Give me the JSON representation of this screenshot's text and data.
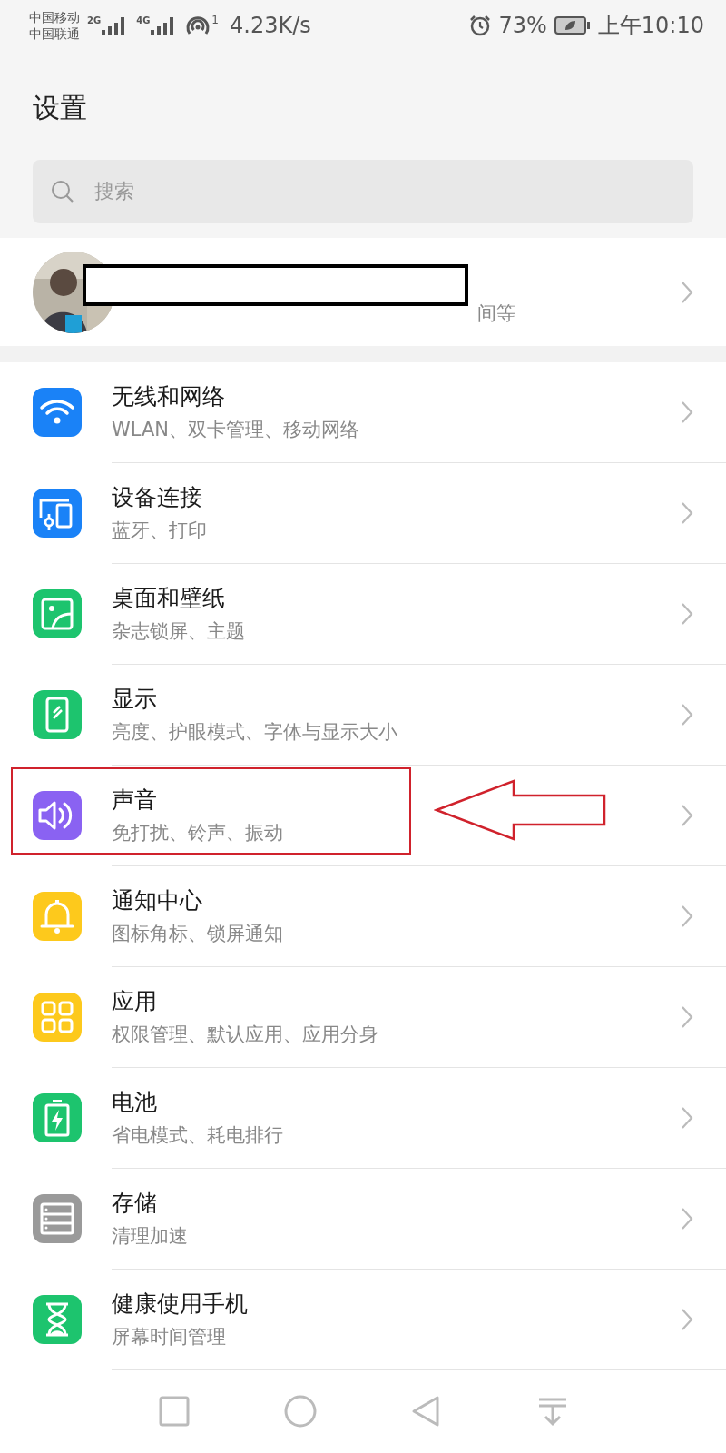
{
  "status_bar": {
    "carriers": [
      "中国移动",
      "中国联通"
    ],
    "signals": [
      {
        "label": "2G"
      },
      {
        "label": "4G"
      }
    ],
    "hotspot_badge": "1",
    "speed": "4.23K/s",
    "battery_percent": "73%",
    "time": "上午10:10"
  },
  "header": {
    "title": "设置"
  },
  "search": {
    "placeholder": "搜索"
  },
  "account": {
    "subtitle_visible": "间等"
  },
  "items": [
    {
      "kind": "wifi",
      "color": "#1a82f7",
      "title": "无线和网络",
      "subtitle": "WLAN、双卡管理、移动网络",
      "highlighted": false
    },
    {
      "kind": "devices",
      "color": "#1a82f7",
      "title": "设备连接",
      "subtitle": "蓝牙、打印",
      "highlighted": false
    },
    {
      "kind": "wallpaper",
      "color": "#1dc46e",
      "title": "桌面和壁纸",
      "subtitle": "杂志锁屏、主题",
      "highlighted": false
    },
    {
      "kind": "display",
      "color": "#1dc46e",
      "title": "显示",
      "subtitle": "亮度、护眼模式、字体与显示大小",
      "highlighted": false
    },
    {
      "kind": "sound",
      "color": "#8a62f2",
      "title": "声音",
      "subtitle": "免打扰、铃声、振动",
      "highlighted": true
    },
    {
      "kind": "bell",
      "color": "#fdc91c",
      "title": "通知中心",
      "subtitle": "图标角标、锁屏通知",
      "highlighted": false
    },
    {
      "kind": "apps",
      "color": "#fdc91c",
      "title": "应用",
      "subtitle": "权限管理、默认应用、应用分身",
      "highlighted": false
    },
    {
      "kind": "battery",
      "color": "#1dc46e",
      "title": "电池",
      "subtitle": "省电模式、耗电排行",
      "highlighted": false
    },
    {
      "kind": "storage",
      "color": "#9a9a9a",
      "title": "存储",
      "subtitle": "清理加速",
      "highlighted": false
    },
    {
      "kind": "hourglass",
      "color": "#1dc46e",
      "title": "健康使用手机",
      "subtitle": "屏幕时间管理",
      "highlighted": false
    }
  ],
  "nav_bar": [
    {
      "kind": "square"
    },
    {
      "kind": "circle"
    },
    {
      "kind": "triangle"
    },
    {
      "kind": "pulldown"
    }
  ]
}
